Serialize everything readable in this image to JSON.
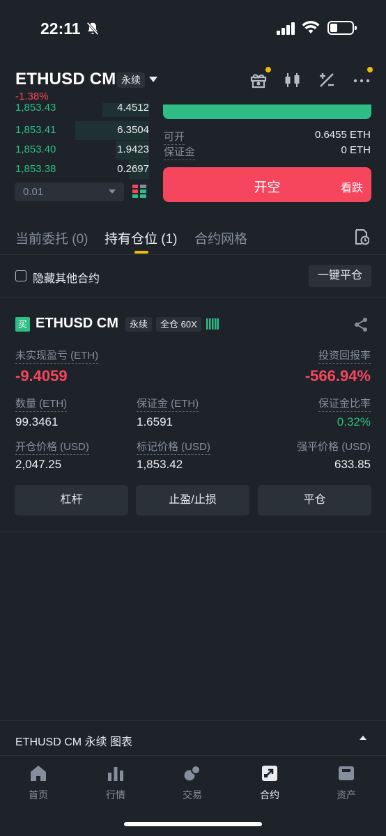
{
  "status_bar": {
    "time": "22:11"
  },
  "header": {
    "pair": "ETHUSD CM",
    "perp_badge": "永续",
    "change": "-1.38%"
  },
  "order_book": {
    "rows": [
      {
        "price": "1,853.43",
        "qty": "4.4512",
        "depth": 0.35
      },
      {
        "price": "1,853.41",
        "qty": "6.3504",
        "depth": 0.55
      },
      {
        "price": "1,853.40",
        "qty": "1.9423",
        "depth": 0.25
      },
      {
        "price": "1,853.38",
        "qty": "0.2697",
        "depth": 0.15
      }
    ],
    "precision": "0.01"
  },
  "trade_panel": {
    "available_label": "可开",
    "available_value": "0.6455 ETH",
    "margin_label": "保证金",
    "margin_value": "0 ETH",
    "sell_label": "开空",
    "sell_sub": "看跌"
  },
  "tabs": {
    "open_orders": "当前委托 (0)",
    "positions": "持有仓位 (1)",
    "grid": "合约网格"
  },
  "filter": {
    "hide_other": "隐藏其他合约",
    "close_all": "一键平仓"
  },
  "position": {
    "side": "买",
    "symbol": "ETHUSD CM",
    "perp": "永续",
    "margin_mode": "全仓 60X",
    "pnl_label": "未实现盈亏 (ETH)",
    "pnl_value": "-9.4059",
    "roe_label": "投资回报率",
    "roe_value": "-566.94%",
    "size_label": "数量 (ETH)",
    "size_value": "99.3461",
    "margin_label": "保证金 (ETH)",
    "margin_value": "1.6591",
    "margin_ratio_label": "保证金比率",
    "margin_ratio_value": "0.32%",
    "entry_label": "开仓价格 (USD)",
    "entry_value": "2,047.25",
    "mark_label": "标记价格 (USD)",
    "mark_value": "1,853.42",
    "liq_label": "强平价格 (USD)",
    "liq_value": "633.85",
    "btn_leverage": "杠杆",
    "btn_tpsl": "止盈/止损",
    "btn_close": "平仓"
  },
  "chart_bar": {
    "label": "ETHUSD CM 永续  图表"
  },
  "nav": {
    "home": "首页",
    "markets": "行情",
    "trade": "交易",
    "futures": "合约",
    "assets": "资产"
  },
  "colors": {
    "background": "#1e2329",
    "green": "#2ebd85",
    "red": "#f6465d",
    "accent": "#f0b90b"
  }
}
